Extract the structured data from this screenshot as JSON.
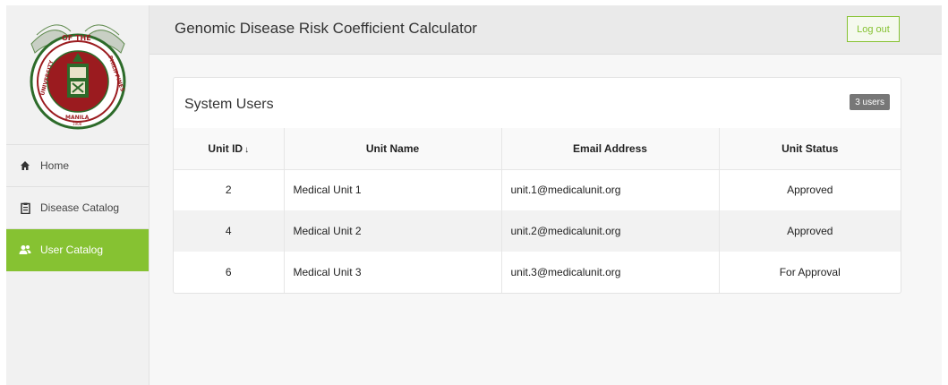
{
  "app": {
    "title": "Genomic Disease Risk Coefficient Calculator",
    "logout_label": "Log out",
    "accent_color": "#86c232"
  },
  "logo": {
    "text_top": "OF THE",
    "text_left": "UNIVERSITY",
    "text_right": "PHILIPPINES",
    "text_bottom": "MANILA",
    "year": "1908"
  },
  "sidebar": {
    "items": [
      {
        "label": "Home",
        "icon": "home-icon",
        "active": false
      },
      {
        "label": "Disease Catalog",
        "icon": "clipboard-icon",
        "active": false
      },
      {
        "label": "User Catalog",
        "icon": "users-icon",
        "active": true
      }
    ]
  },
  "card": {
    "title": "System Users",
    "badge": "3 users"
  },
  "table": {
    "headers": [
      "Unit ID",
      "Unit Name",
      "Email Address",
      "Unit Status"
    ],
    "sort_indicator": "↓",
    "rows": [
      {
        "id": "2",
        "name": "Medical Unit 1",
        "email": "unit.1@medicalunit.org",
        "status": "Approved"
      },
      {
        "id": "4",
        "name": "Medical Unit 2",
        "email": "unit.2@medicalunit.org",
        "status": "Approved"
      },
      {
        "id": "6",
        "name": "Medical Unit 3",
        "email": "unit.3@medicalunit.org",
        "status": "For Approval"
      }
    ]
  }
}
